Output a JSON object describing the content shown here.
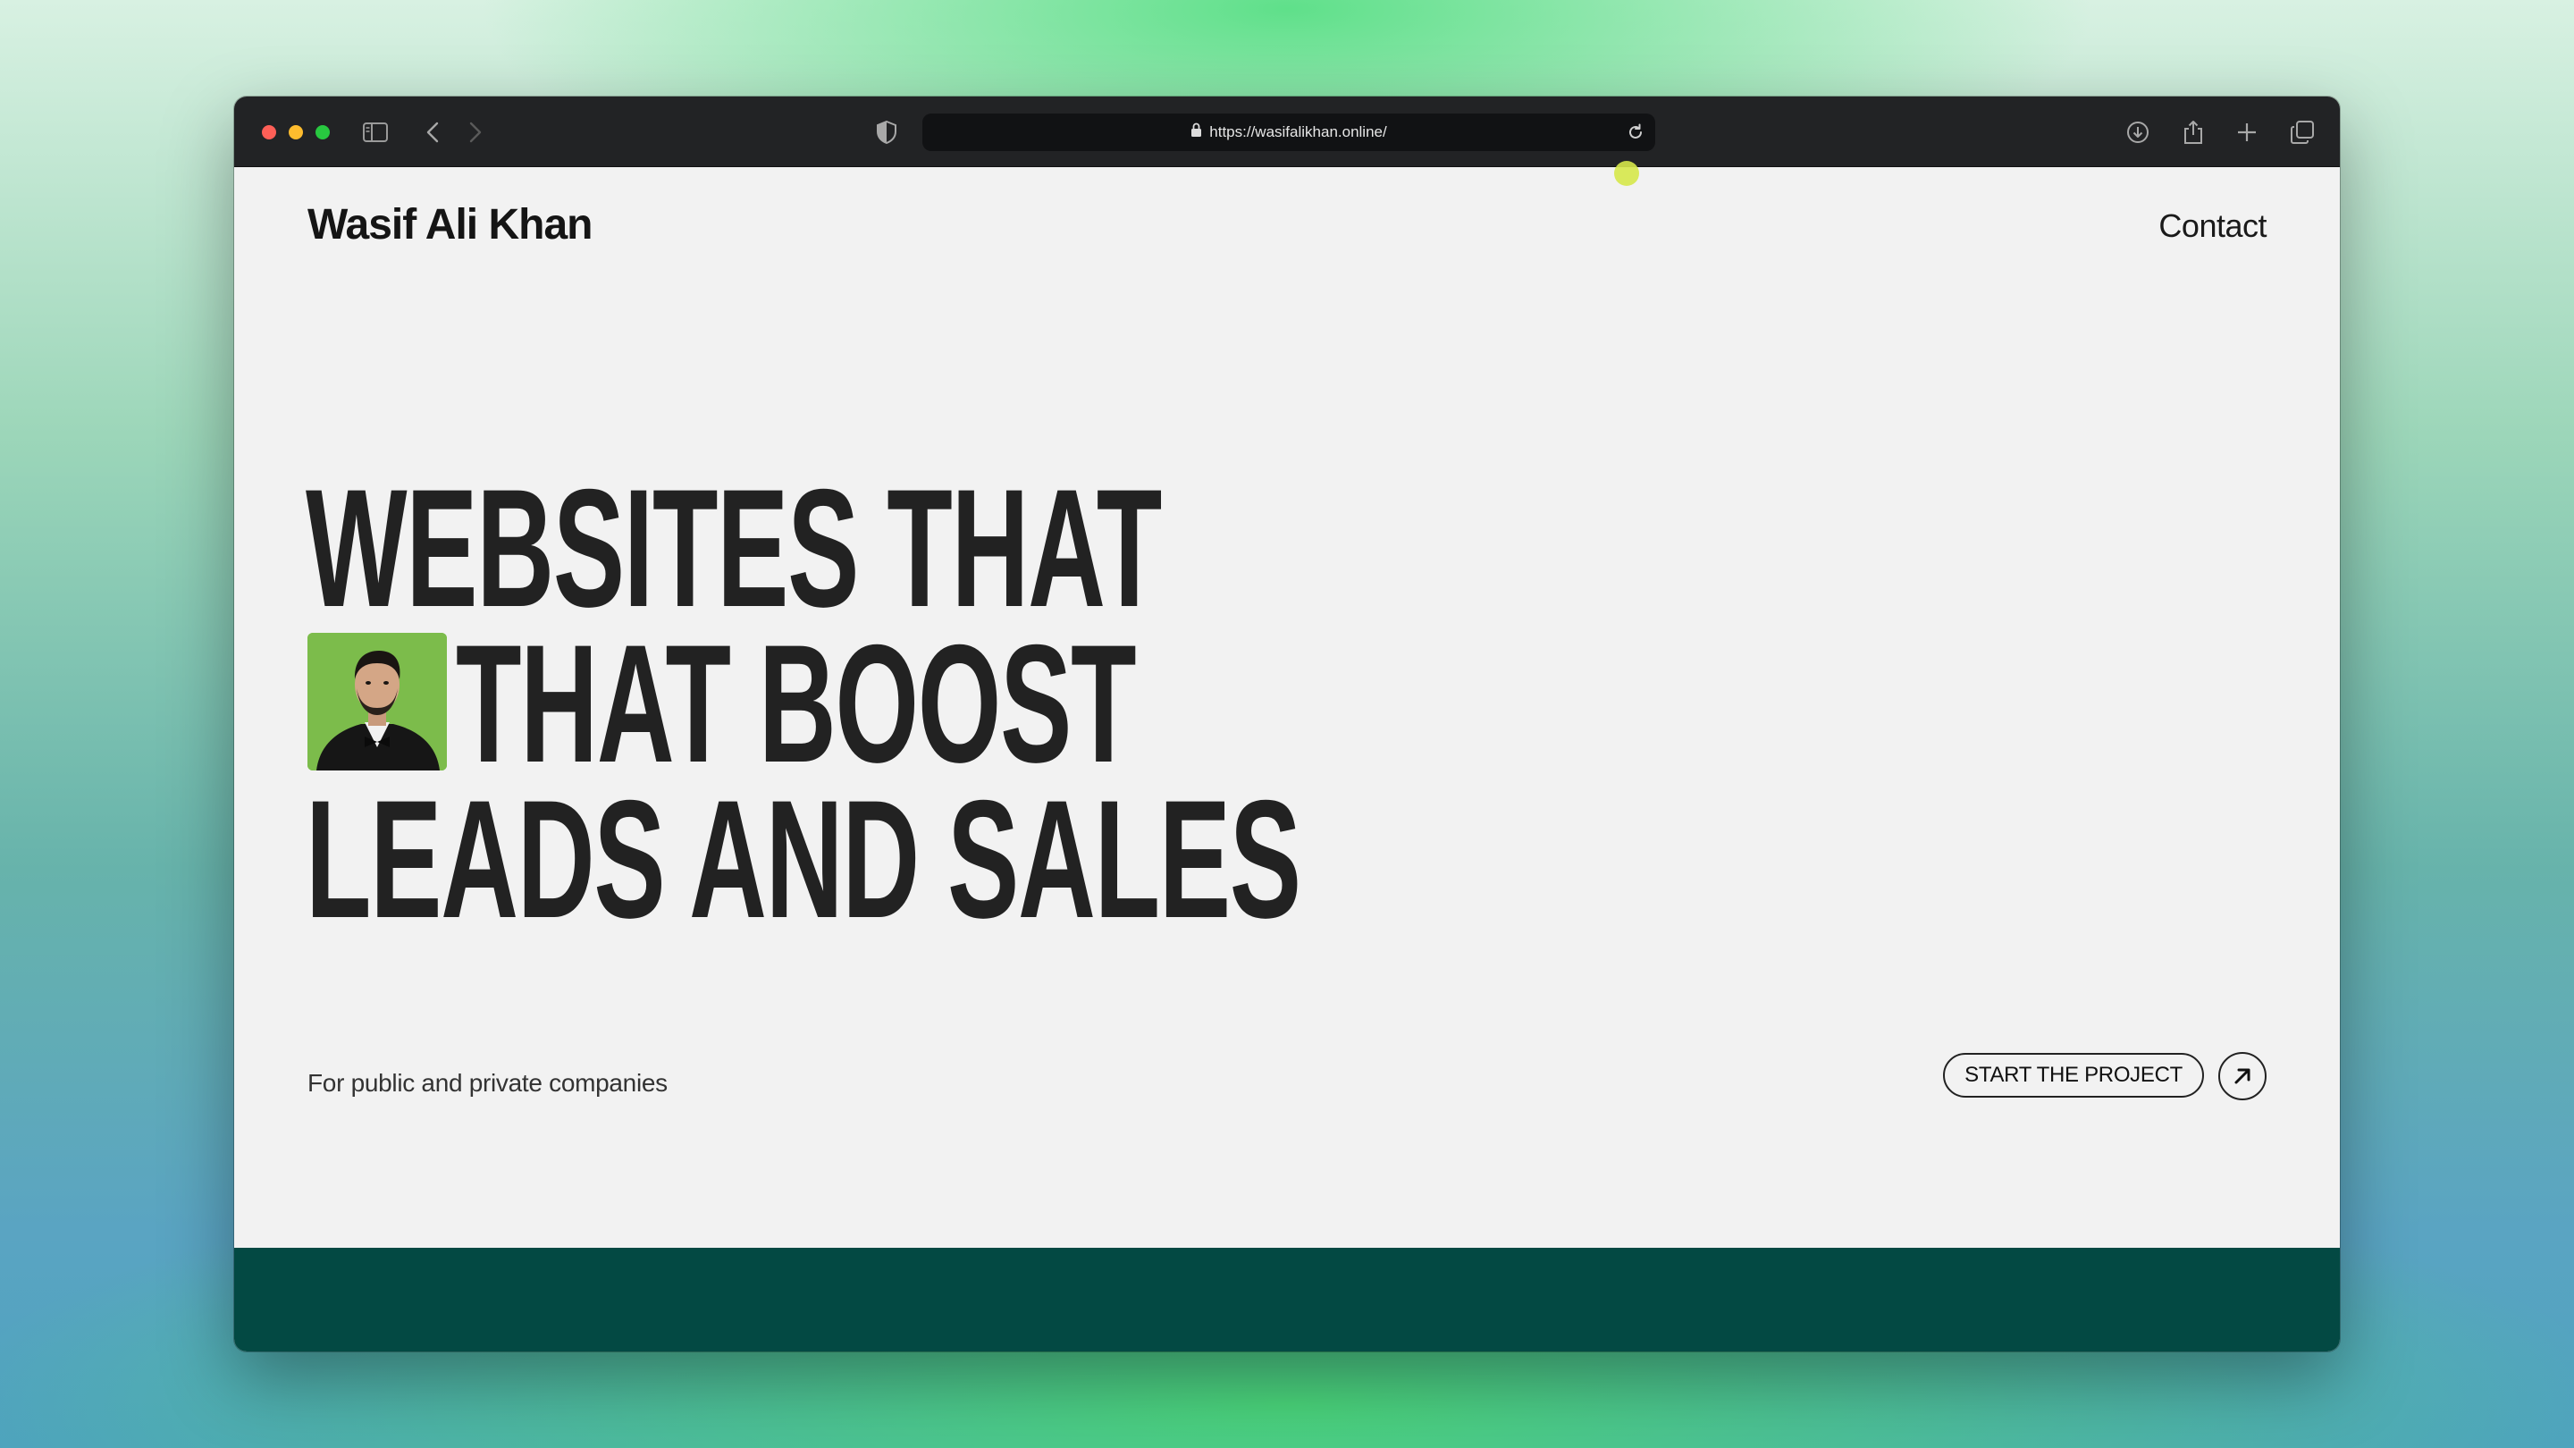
{
  "browser": {
    "url": "https://wasifalikhan.online/",
    "icons": [
      "sidebar-icon",
      "back-icon",
      "forward-icon",
      "shield-icon",
      "lock-icon",
      "reload-icon",
      "download-icon",
      "share-icon",
      "new-tab-icon",
      "tabs-overview-icon"
    ]
  },
  "header": {
    "brand": "Wasif Ali Khan",
    "nav_contact": "Contact"
  },
  "hero": {
    "line1": "WEBSITES THAT",
    "line2": "THAT BOOST",
    "line3": "LEADS AND SALES",
    "subtitle": "For public and private companies",
    "cta_label": "START THE PROJECT"
  },
  "colors": {
    "page_bg": "#f2f2f2",
    "footer_band": "#034943",
    "toolbar": "#222325",
    "photo_bg": "#7cbc4b"
  }
}
